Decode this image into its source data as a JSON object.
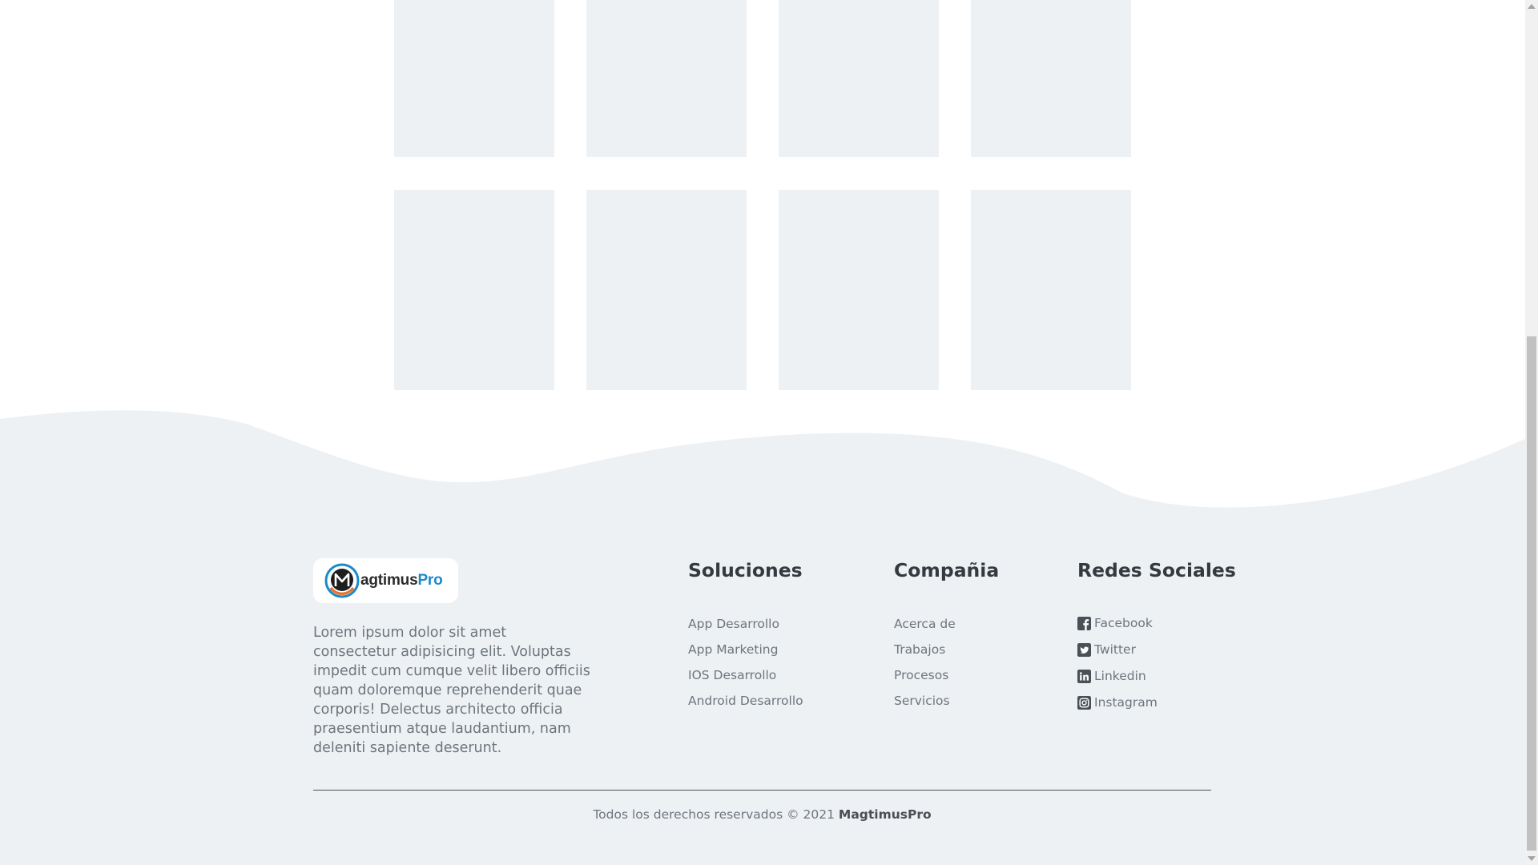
{
  "brand": {
    "logo_main": "agtimus",
    "logo_accent": "Pro",
    "logo_icon": "magtimus-logo-icon",
    "description": "Lorem ipsum dolor sit amet consectetur adipisicing elit. Voluptas impedit cum cumque velit libero officiis quam doloremque reprehenderit quae corporis! Delectus architecto officia praesentium atque laudantium, nam deleniti sapiente deserunt."
  },
  "columns": {
    "soluciones": {
      "title": "Soluciones",
      "links": [
        "App Desarrollo",
        "App Marketing",
        "IOS Desarrollo",
        "Android Desarrollo"
      ]
    },
    "compania": {
      "title": "Compañia",
      "links": [
        "Acerca de",
        "Trabajos",
        "Procesos",
        "Servicios"
      ]
    },
    "redes": {
      "title": "Redes Sociales",
      "links": [
        {
          "label": "Facebook",
          "icon": "facebook-icon"
        },
        {
          "label": "Twitter",
          "icon": "twitter-icon"
        },
        {
          "label": "Linkedin",
          "icon": "linkedin-icon"
        },
        {
          "label": "Instagram",
          "icon": "instagram-icon"
        }
      ]
    }
  },
  "footer": {
    "copyright_prefix": "Todos los derechos reservados © 2021",
    "copyright_brand": "MagtimusPro"
  },
  "colors": {
    "footer_bg": "#eef1f4",
    "placeholder_card": "#eef1f4",
    "accent_blue": "#1b8ac9",
    "logo_orange": "#e8732a"
  }
}
